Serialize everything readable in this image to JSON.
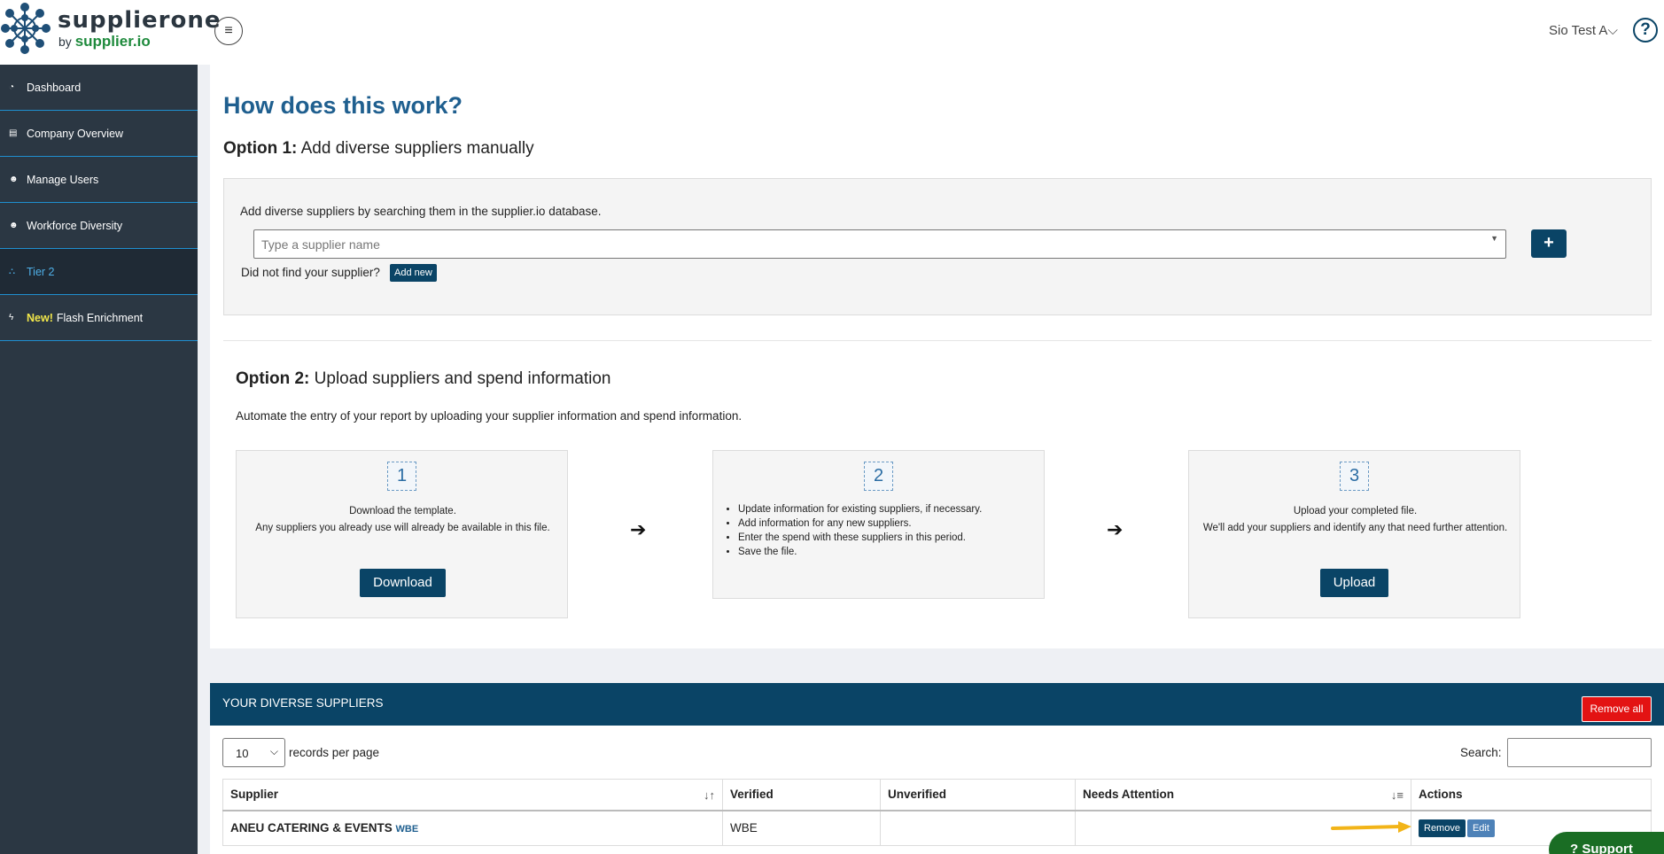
{
  "header": {
    "logo_main": "supplierone",
    "logo_by": "by",
    "logo_sub": "supplier.io",
    "user": "Sio Test A",
    "user_caret": "⌵",
    "help": "?",
    "menu_icon": "≡"
  },
  "sidebar": {
    "items": [
      {
        "label": "Dashboard",
        "icon": "dashboard-icon",
        "glyph": "◔"
      },
      {
        "label": "Company Overview",
        "icon": "building-icon",
        "glyph": "▤"
      },
      {
        "label": "Manage Users",
        "icon": "users-icon",
        "glyph": "☻"
      },
      {
        "label": "Workforce Diversity",
        "icon": "users-icon",
        "glyph": "☻"
      },
      {
        "label": "Tier 2",
        "icon": "sitemap-icon",
        "glyph": "⛬"
      },
      {
        "label": "Flash Enrichment",
        "icon": "bolt-icon",
        "glyph": "ϟ",
        "tag": "New!"
      }
    ]
  },
  "main": {
    "title": "How does this work?",
    "option1": {
      "label": "Option 1:",
      "text": "Add diverse suppliers manually",
      "description": "Add diverse suppliers by searching them in the supplier.io database.",
      "placeholder": "Type a supplier name",
      "plus": "+",
      "not_found": "Did not find your supplier?",
      "add_new": "Add new"
    },
    "option2": {
      "label": "Option 2:",
      "text": "Upload suppliers and spend information",
      "description": "Automate the entry of your report by uploading your supplier information and spend information.",
      "steps": [
        {
          "num": "1",
          "lines": [
            "Download the template.",
            "Any suppliers you already use will already be available in this file."
          ],
          "button": "Download"
        },
        {
          "num": "2",
          "bullets": [
            "Update information for existing suppliers, if necessary.",
            "Add information for any new suppliers.",
            "Enter the spend with these suppliers in this period.",
            "Save the file."
          ]
        },
        {
          "num": "3",
          "lines": [
            "Upload your completed file.",
            "We'll add your suppliers and identify any that need further attention."
          ],
          "button": "Upload"
        }
      ],
      "arrow": "➔"
    }
  },
  "suppliers": {
    "title": "YOUR DIVERSE SUPPLIERS",
    "remove_all": "Remove all",
    "per_page": "10",
    "per_page_label": "records per page",
    "search_label": "Search:",
    "columns": [
      "Supplier",
      "Verified",
      "Unverified",
      "Needs Attention",
      "Actions"
    ],
    "rows": [
      {
        "supplier": "ANEU CATERING & EVENTS",
        "tag": "WBE",
        "verified": "WBE",
        "unverified": "",
        "needs_attention": "",
        "remove": "Remove",
        "edit": "Edit"
      }
    ]
  },
  "support": {
    "label": "Support",
    "icon": "?"
  },
  "colors": {
    "primary": "#0a4466",
    "sidebar": "#2b3743",
    "danger": "#e31313",
    "accent": "#1f8fd0",
    "support": "#1a6d24"
  }
}
